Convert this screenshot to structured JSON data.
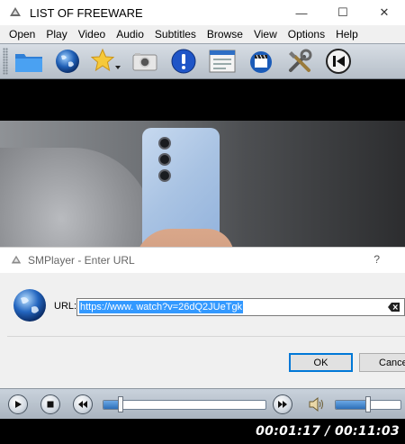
{
  "window": {
    "title": "LIST OF FREEWARE"
  },
  "window_controls": {
    "minimize": "—",
    "maximize": "☐",
    "close": "✕"
  },
  "menu": [
    "Open",
    "Play",
    "Video",
    "Audio",
    "Subtitles",
    "Browse",
    "View",
    "Options",
    "Help"
  ],
  "toolbar": {
    "buttons": [
      "open-folder-icon",
      "globe-url-icon",
      "favorites-star-icon",
      "screenshot-camera-icon",
      "info-icon",
      "playlist-icon",
      "video-clapper-icon",
      "preferences-tools-icon",
      "previous-icon"
    ]
  },
  "dialog": {
    "title": "SMPlayer - Enter URL",
    "help": "?",
    "url_label": "URL:",
    "url_value": "https://www.             watch?v=26dQ2JUeTgk",
    "ok_label": "OK",
    "cancel_label": "Cancel"
  },
  "playback": {
    "seek_position": 0.11,
    "volume_level": 0.5,
    "time_display": "00:01:17 / 00:11:03"
  },
  "colors": {
    "selection": "#3399ff",
    "toolbar_gradient_top": "#d7dde4",
    "progress_fill": "#2d6fb8"
  }
}
